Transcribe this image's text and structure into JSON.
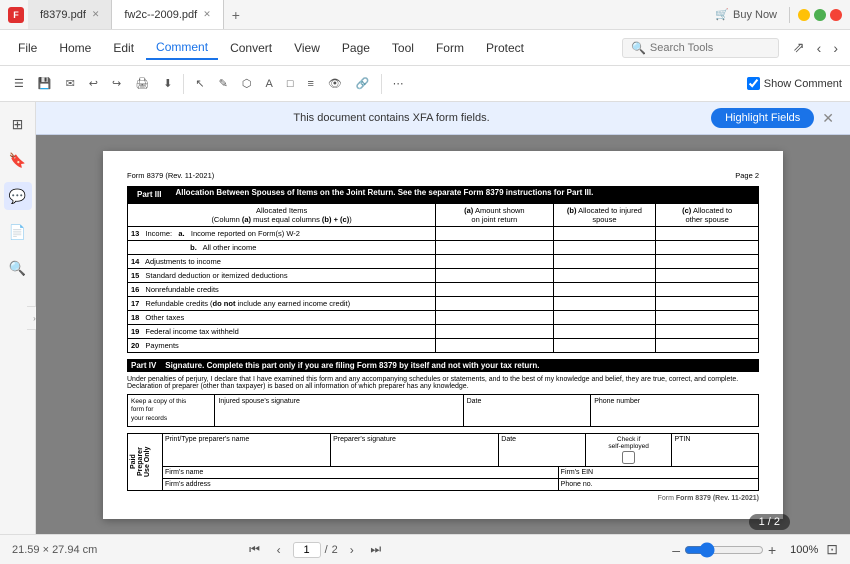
{
  "titleBar": {
    "appIcon": "F",
    "tabs": [
      {
        "label": "f8379.pdf",
        "active": false
      },
      {
        "label": "fw2c--2009.pdf",
        "active": true
      }
    ],
    "newTabTitle": "+",
    "buyNow": "Buy Now",
    "windowControls": {
      "minimize": "–",
      "maximize": "□",
      "close": "✕"
    }
  },
  "menuBar": {
    "items": [
      {
        "label": "File",
        "active": false
      },
      {
        "label": "Home",
        "active": false
      },
      {
        "label": "Edit",
        "active": false
      },
      {
        "label": "Comment",
        "active": true
      },
      {
        "label": "Convert",
        "active": false
      },
      {
        "label": "View",
        "active": false
      },
      {
        "label": "Page",
        "active": false
      },
      {
        "label": "Tool",
        "active": false
      },
      {
        "label": "Form",
        "active": false
      },
      {
        "label": "Protect",
        "active": false
      }
    ],
    "searchPlaceholder": "Search Tools",
    "icons": [
      "⇗",
      "‹",
      "›"
    ]
  },
  "toolbar": {
    "tools": [
      "☰",
      "💾",
      "✉",
      "↩",
      "↪",
      "🖨",
      "⬇",
      "|",
      "↖",
      "✎",
      "⬡",
      "A",
      "□",
      "≡",
      "👁",
      "🔗",
      "|",
      "Show Comment"
    ],
    "showComment": "Show Comment",
    "showCommentChecked": true
  },
  "sidebar": {
    "icons": [
      {
        "name": "thumbnails",
        "symbol": "⊞",
        "active": false
      },
      {
        "name": "bookmarks",
        "symbol": "🔖",
        "active": false
      },
      {
        "name": "comments",
        "symbol": "💬",
        "active": true
      },
      {
        "name": "pages",
        "symbol": "📄",
        "active": false
      },
      {
        "name": "search",
        "symbol": "🔍",
        "active": false
      }
    ]
  },
  "notification": {
    "text": "This document contains XFA form fields.",
    "buttonLabel": "Highlight Fields",
    "closeSymbol": "✕"
  },
  "pdfPage": {
    "formInfo": "Form 8379 (Rev. 11-2021)",
    "pageNum": "Page 2",
    "partIII": {
      "label": "Part III",
      "title": "Allocation Between Spouses of Items on the Joint Return.",
      "subtitle": "See the separate Form 8379 instructions for Part III.",
      "columnHeaders": {
        "items": "Allocated Items\n(Column (a) must equal columns (b) + (c))",
        "colA": "(a) Amount shown\non joint return",
        "colB": "(b) Allocated to injured\nspouse",
        "colC": "(c) Allocated to\nother spouse"
      },
      "rows": [
        {
          "num": "13",
          "label": "Income:",
          "sub": [
            {
              "letter": "a.",
              "text": "Income reported on Form(s) W-2"
            },
            {
              "letter": "b.",
              "text": "All other income"
            }
          ]
        },
        {
          "num": "14",
          "label": "Adjustments to income"
        },
        {
          "num": "15",
          "label": "Standard deduction or itemized deductions"
        },
        {
          "num": "16",
          "label": "Nonrefundable credits"
        },
        {
          "num": "17",
          "label": "Refundable credits (do not include any earned income credit)"
        },
        {
          "num": "18",
          "label": "Other taxes"
        },
        {
          "num": "19",
          "label": "Federal income tax withheld"
        },
        {
          "num": "20",
          "label": "Payments"
        }
      ]
    },
    "partIV": {
      "label": "Part IV",
      "title": "Signature.",
      "text": "Complete this part only if you are filing Form 8379 by itself and not with your tax return."
    },
    "penalties": "Under penalties of perjury, I declare that I have examined this form and any accompanying schedules or statements, and to the best of my knowledge and belief, they are true, correct, and complete. Declaration of preparer (other than taxpayer) is based on all information of which preparer has any knowledge.",
    "signatureFields": {
      "injuredSpouseSignature": "Injured spouse's signature",
      "date1": "Date",
      "phoneNumber": "Phone number",
      "keepCopy": "Keep a copy of this form for your records"
    },
    "paidPreparer": {
      "sectionTitle": "Paid\nPreparer\nUse Only",
      "printName": "Print/Type preparer's name",
      "preparerSignature": "Preparer's signature",
      "date2": "Date",
      "checkLabel": "Check if\nself-employed",
      "ptin": "PTIN",
      "firmsName": "Firm's name",
      "firmsEIN": "Firm's EIN",
      "firmsAddress": "Firm's address",
      "phoneNo": "Phone no."
    },
    "footerNote": "Form 8379 (Rev. 11-2021)"
  },
  "statusBar": {
    "dimensions": "21.59 × 27.94 cm",
    "pageInput": "1",
    "pageSep": "/",
    "totalPages": "2",
    "navButtons": {
      "first": "⏮",
      "prev": "‹",
      "next": "›",
      "last": "⏭"
    },
    "zoomMinus": "–",
    "zoomPlus": "+",
    "zoomValue": "100%",
    "pageIndicator": "1 / 2"
  }
}
